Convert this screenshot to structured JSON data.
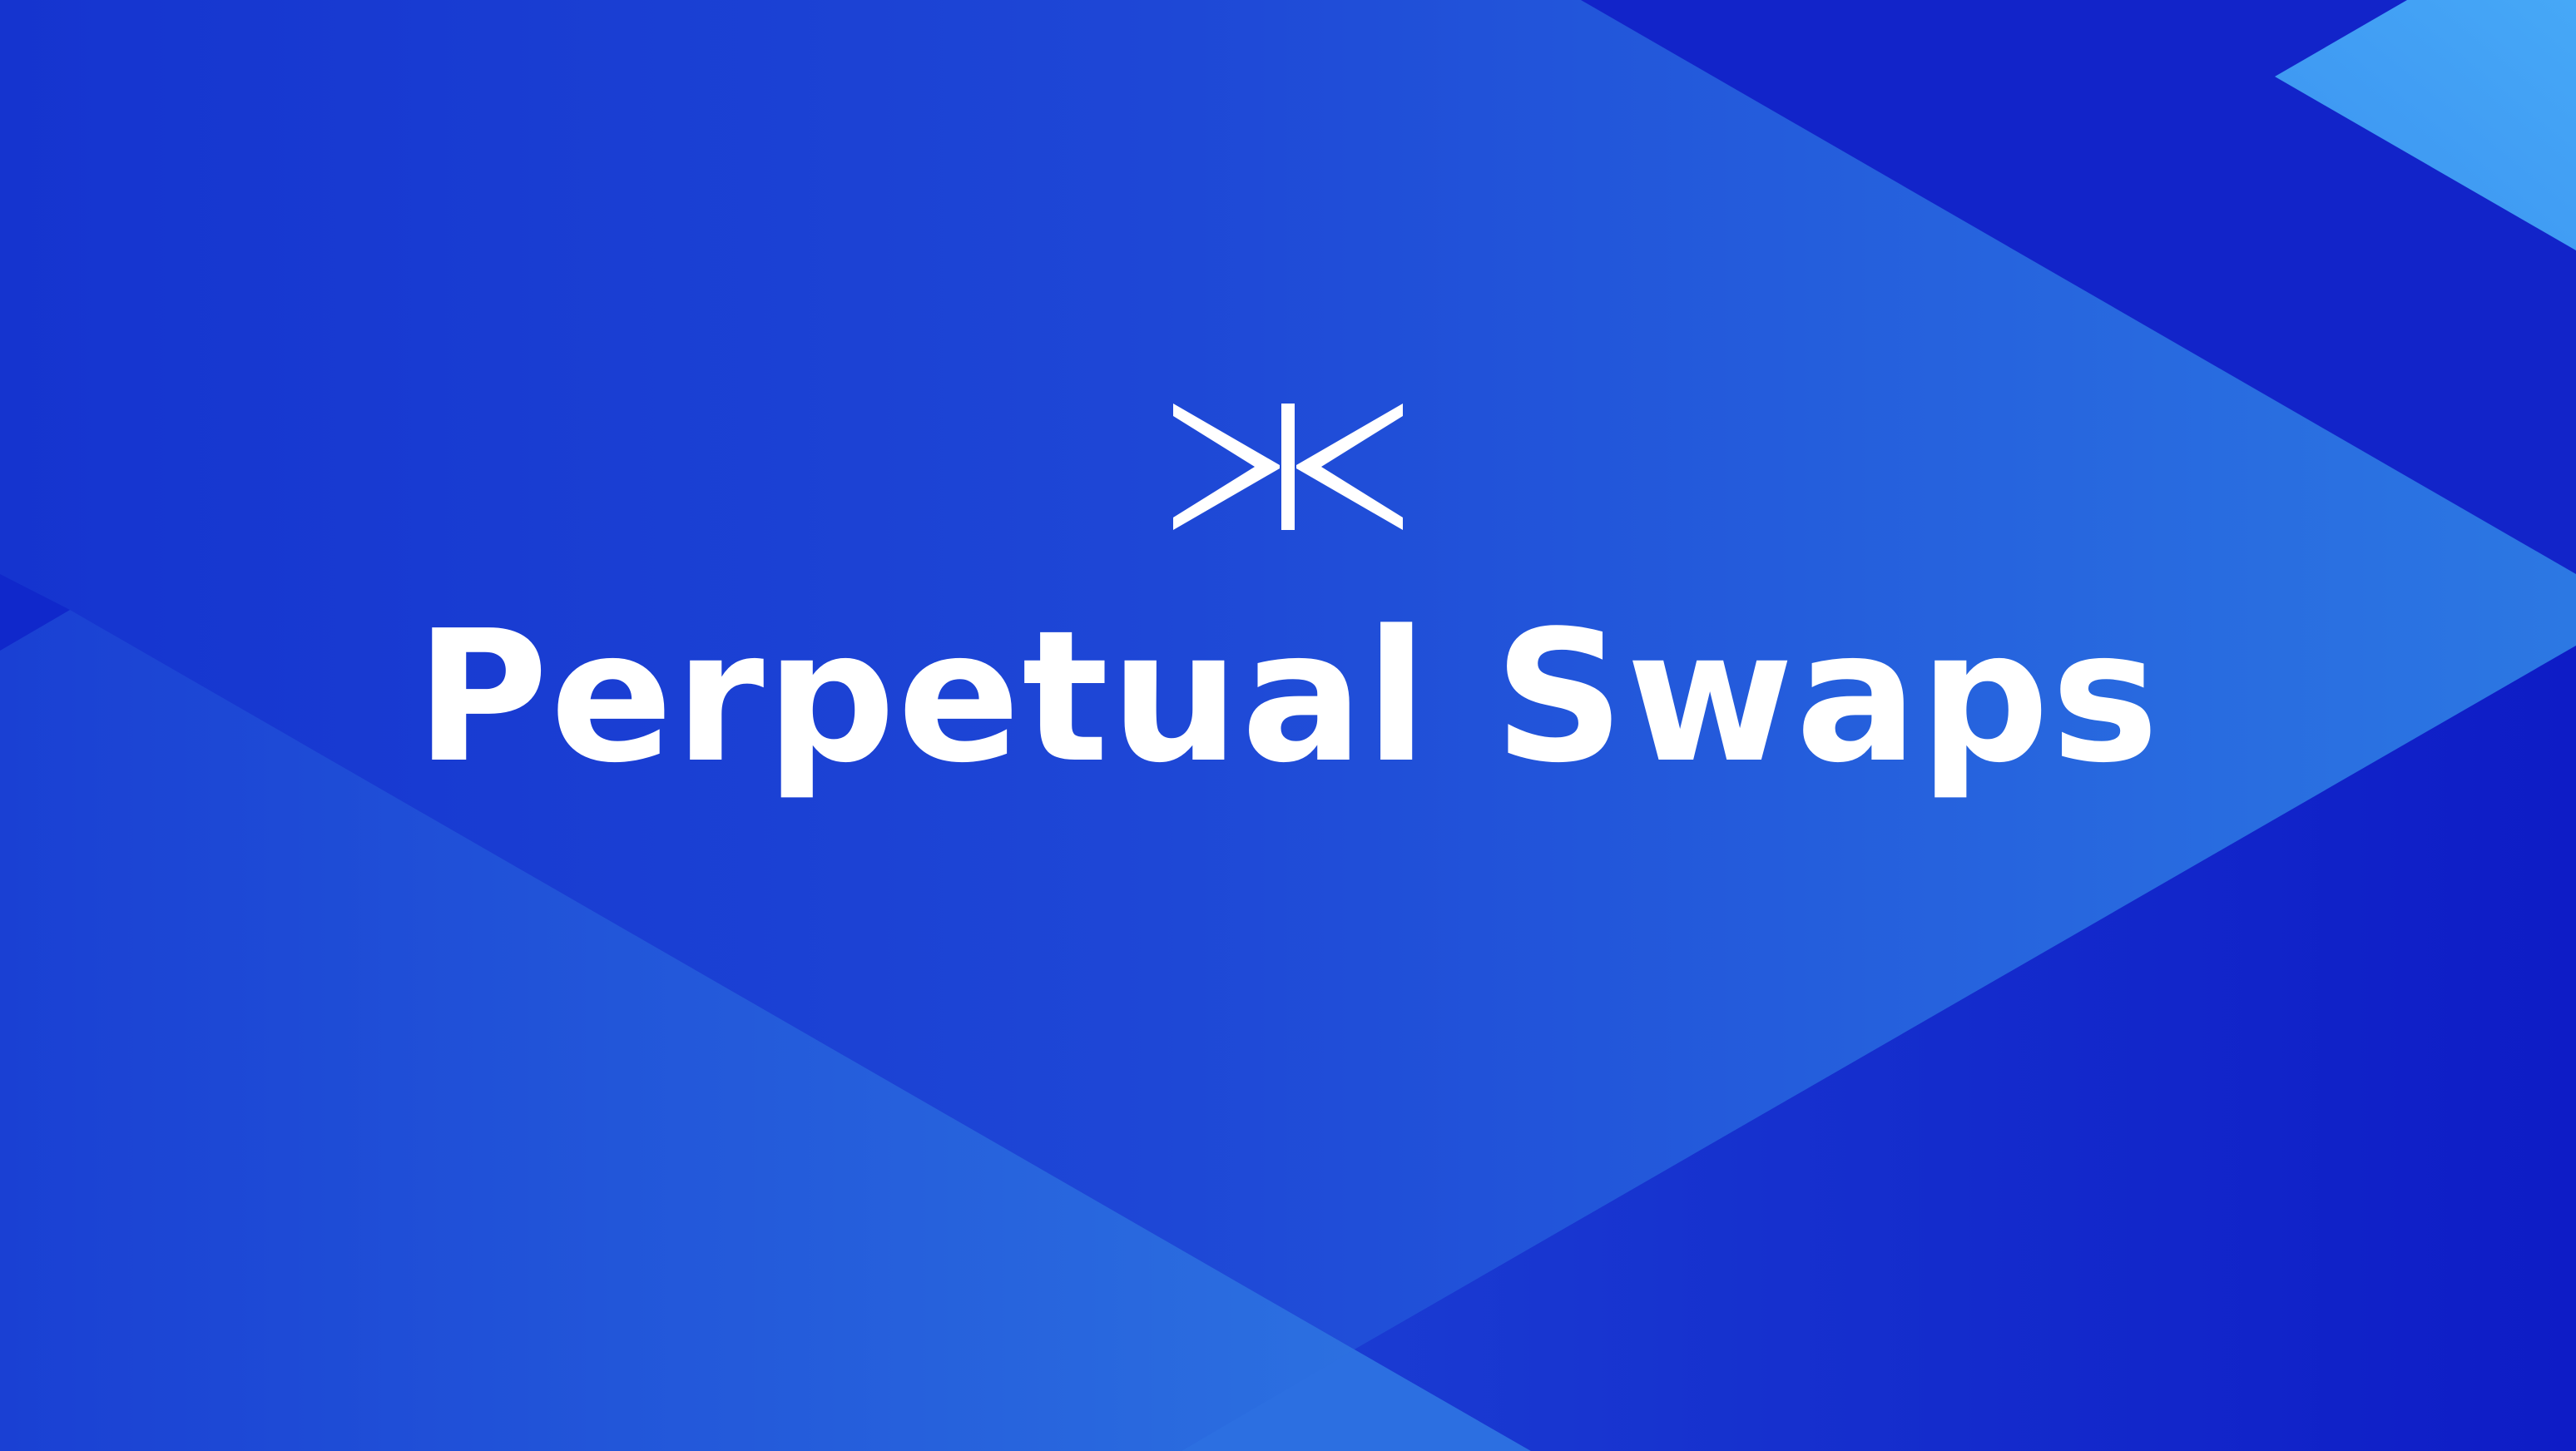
{
  "title": "Perpetual Swaps",
  "colors": {
    "background_dark": "#0f1fc8",
    "band_light": "#2f79e4",
    "band_mid": "#1e44d4",
    "corner_accent": "#43a2f6",
    "text": "#ffffff"
  },
  "icons": {
    "logo": "bowtie-x-logo-icon"
  }
}
